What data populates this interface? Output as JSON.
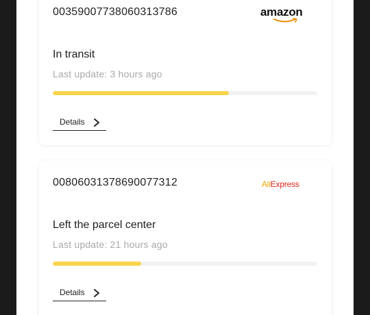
{
  "shipments": [
    {
      "tracking_number": "00359007738060313786",
      "carrier_logo": "amazon",
      "status": "In transit",
      "last_update": "Last update: 3 hours ago",
      "progress_fraction": 0.665,
      "details_label": "Details"
    },
    {
      "tracking_number": "00806031378690077312",
      "carrier_logo": "AliExpress",
      "status": "Left the parcel center",
      "last_update": "Last update: 21 hours ago",
      "progress_fraction": 0.335,
      "details_label": "Details"
    }
  ],
  "colors": {
    "progress_fill": "#f7d44c",
    "progress_track": "#f2f2f2",
    "muted_text": "#a9a9a9",
    "aliexpress_red": "#e2231a",
    "amazon_smile": "#f08804"
  },
  "icons": {
    "details_chevron": "chevron-right-icon"
  }
}
